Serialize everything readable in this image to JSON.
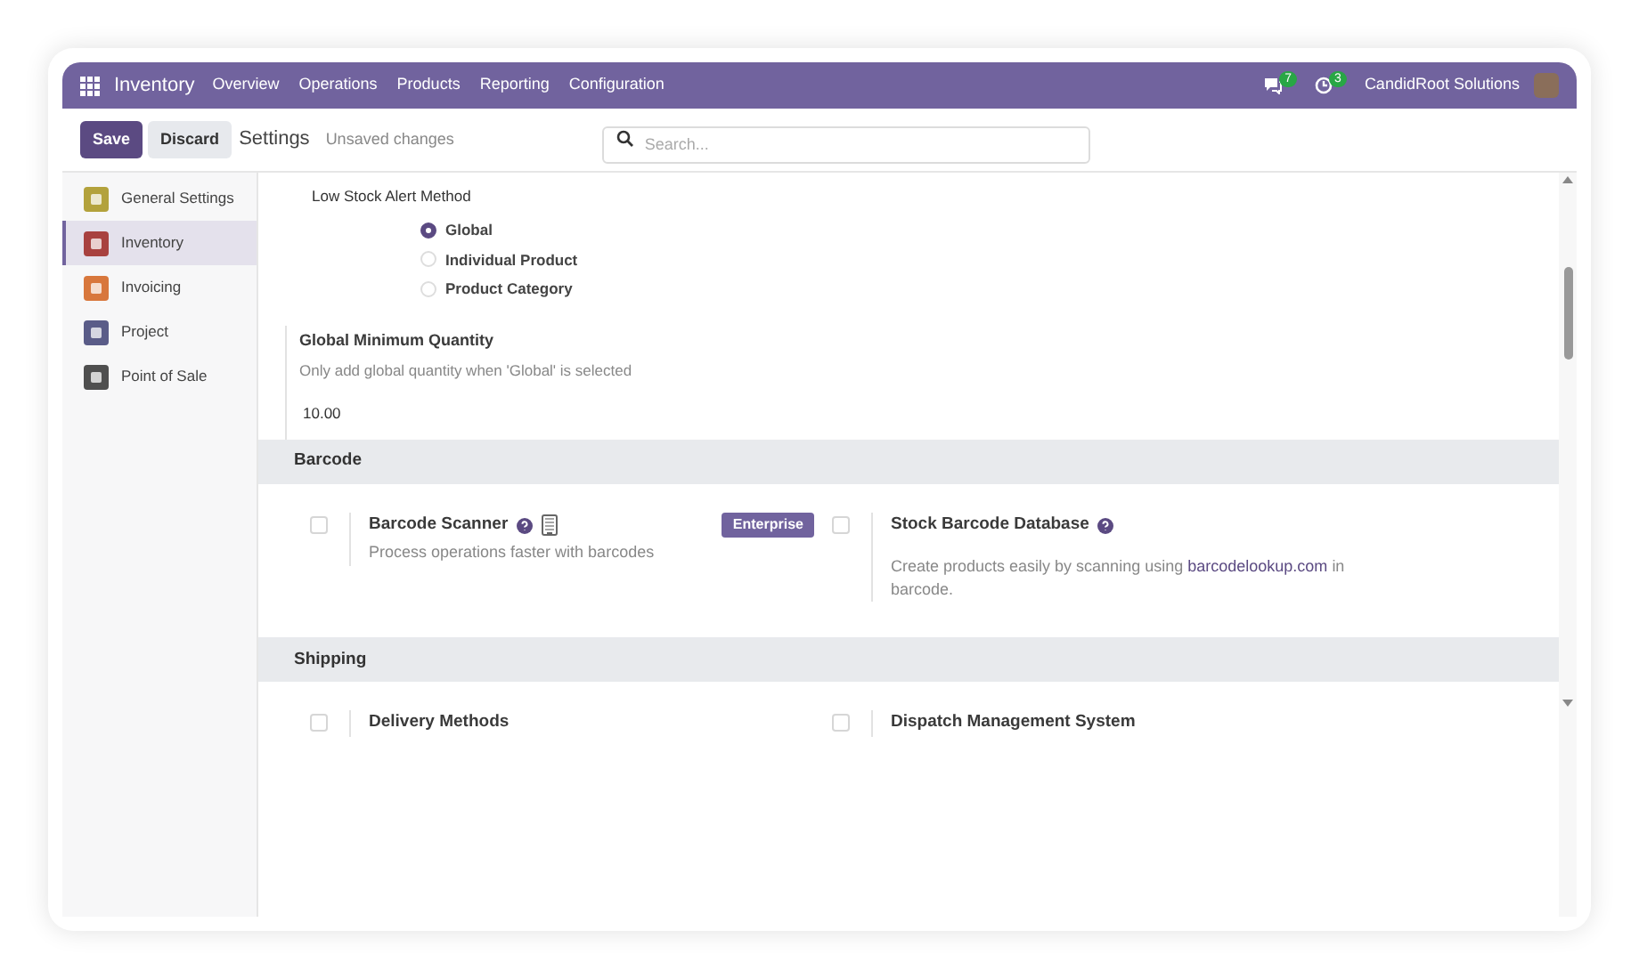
{
  "navbar": {
    "app_name": "Inventory",
    "menu": [
      "Overview",
      "Operations",
      "Products",
      "Reporting",
      "Configuration"
    ],
    "notifications": [
      {
        "kind": "chat",
        "count": "7"
      },
      {
        "kind": "activity",
        "count": "3"
      }
    ],
    "company": "CandidRoot Solutions"
  },
  "control_bar": {
    "save": "Save",
    "discard": "Discard",
    "title": "Settings",
    "status": "Unsaved changes",
    "search": {
      "placeholder": "Search..."
    }
  },
  "sidebar": {
    "items": [
      {
        "label": "General Settings",
        "selected": false,
        "color": "#b3a23c"
      },
      {
        "label": "Inventory",
        "selected": true,
        "color": "#a8413f"
      },
      {
        "label": "Invoicing",
        "selected": false,
        "color": "#d8773c"
      },
      {
        "label": "Project",
        "selected": false,
        "color": "#5a5c88"
      },
      {
        "label": "Point of Sale",
        "selected": false,
        "color": "#4f4f4f"
      }
    ]
  },
  "low_stock": {
    "label": "Low Stock Alert Method",
    "options": [
      {
        "label": "Global",
        "selected": true
      },
      {
        "label": "Individual Product",
        "selected": false
      },
      {
        "label": "Product Category",
        "selected": false
      }
    ]
  },
  "global_min": {
    "title": "Global Minimum Quantity",
    "description": "Only add global quantity when 'Global' is selected",
    "value": "10.00"
  },
  "sections": [
    {
      "title": "Barcode",
      "settings": [
        {
          "title": "Barcode Scanner",
          "checked": false,
          "help": true,
          "device": true,
          "description": "Process operations faster with barcodes",
          "badge": "Enterprise"
        },
        {
          "title": "Stock Barcode Database",
          "checked": false,
          "help": true,
          "description": "Create products easily by scanning using",
          "link": "barcodelookup.com",
          "description_end": "in barcode."
        }
      ]
    },
    {
      "title": "Shipping",
      "settings": [
        {
          "title": "Delivery Methods",
          "checked": false
        },
        {
          "title": "Dispatch Management System",
          "checked": false
        }
      ]
    }
  ]
}
